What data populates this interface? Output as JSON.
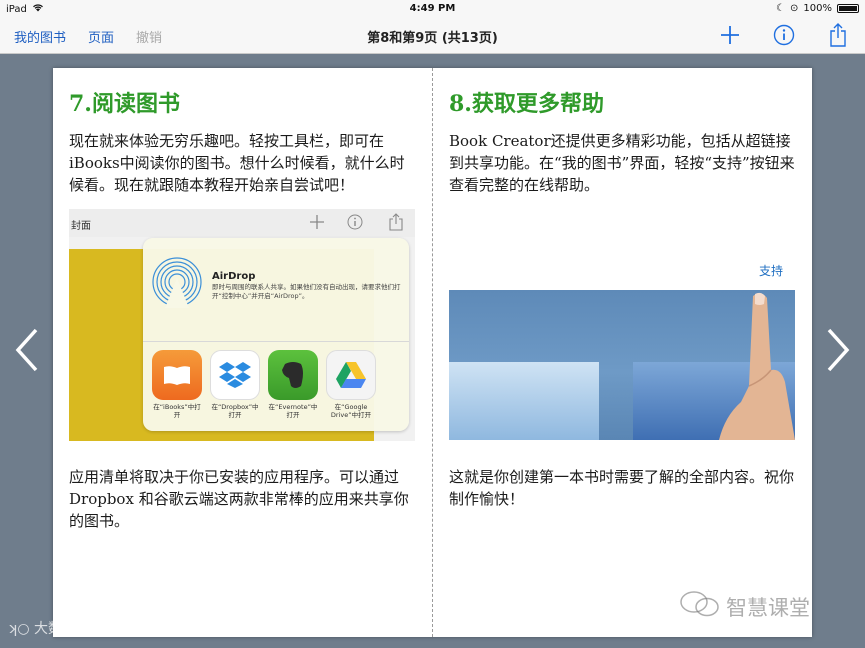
{
  "status_bar": {
    "carrier": "iPad",
    "time": "4:49 PM",
    "battery": "100%"
  },
  "navbar": {
    "my_books": "我的图书",
    "pages": "页面",
    "undo": "撤销",
    "title": "第8和第9页  (共13页)",
    "icons": [
      "plus-icon",
      "info-icon",
      "share-icon"
    ]
  },
  "left_page": {
    "heading": "7.阅读图书",
    "intro": "现在就来体验无穷乐趣吧。轻按工具栏，即可在iBooks中阅读你的图书。想什么时候看，就什么时候看。现在就跟随本教程开始亲自尝试吧！",
    "screenshot": {
      "topbar_label": "封面",
      "airdrop_title": "AirDrop",
      "airdrop_desc": "即时与周围的联系人共享。如果他们没有自动出现，请要求他们打开“控制中心”并开启“AirDrop”。",
      "apps": [
        {
          "caption": "在“iBooks”中打开",
          "color": "#f2892a"
        },
        {
          "caption": "在“Dropbox”中打开",
          "color": "#ffffff"
        },
        {
          "caption": "在“Evernote”中打开",
          "color": "#4aa834"
        },
        {
          "caption": "在“Google Drive”中打开",
          "color": "#f4f4f4"
        }
      ]
    },
    "outro": "应用清单将取决于你已安装的应用程序。可以通过Dropbox 和谷歌云端这两款非常棒的应用来共享你的图书。"
  },
  "right_page": {
    "heading": "8.获取更多帮助",
    "intro": "Book Creator还提供更多精彩功能，包括从超链接到共享功能。在“我的图书”界面，轻按“支持”按钮来查看完整的在线帮助。",
    "support_label": "支持",
    "outro": "这就是你创建第一本书时需要了解的全部内容。祝你制作愉快！"
  },
  "watermarks": {
    "left": "大数跨境",
    "right": "智慧课堂"
  },
  "colors": {
    "heading_green": "#2f9a2a",
    "link_blue": "#1f5fc2",
    "background": "#6f7d8c"
  }
}
